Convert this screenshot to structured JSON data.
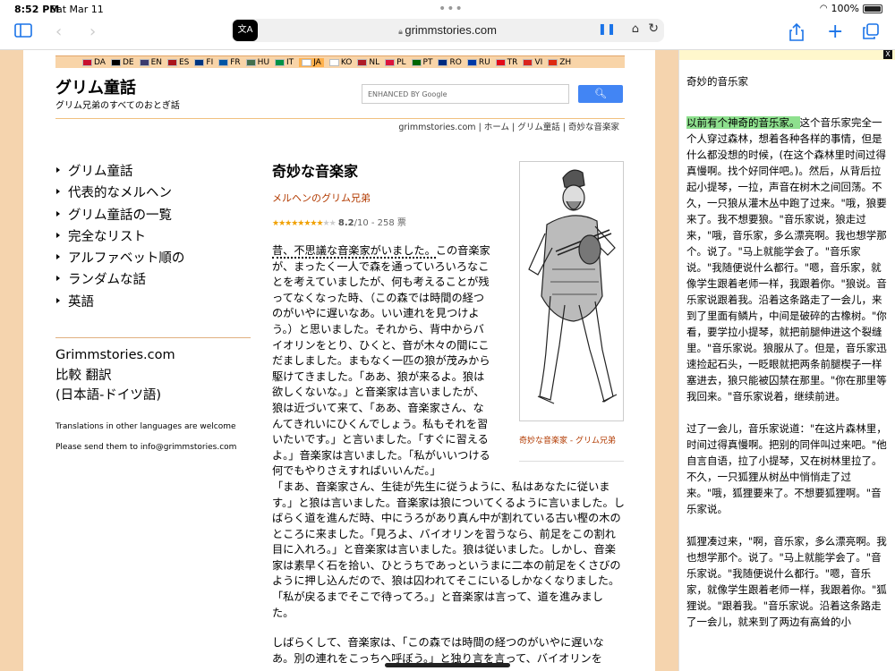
{
  "status": {
    "time": "8:52 PM",
    "date": "Sat Mar 11",
    "battery": "100%"
  },
  "browser": {
    "url": "grimmstories.com",
    "translate_label": "文A"
  },
  "site": {
    "title": "グリム童話",
    "subtitle": "グリム兄弟のすべてのおとぎ話",
    "search_placeholder": "ENHANCED BY Google",
    "languages": [
      "DA",
      "DE",
      "EN",
      "ES",
      "FI",
      "FR",
      "HU",
      "IT",
      "JA",
      "KO",
      "NL",
      "PL",
      "PT",
      "RO",
      "RU",
      "TR",
      "VI",
      "ZH"
    ],
    "active_language": "JA",
    "breadcrumb": "grimmstories.com | ホーム | グリム童話 | 奇妙な音楽家"
  },
  "nav": [
    "グリム童話",
    "代表的なメルヘン",
    "グリム童話の一覧",
    "完全なリスト",
    "アルファベット順の",
    "ランダムな話",
    "英語"
  ],
  "side_block": {
    "l1": "Grimmstories.com",
    "l2": "比較 翻訳",
    "l3": "(日本語-ドイツ語)",
    "t1": "Translations in other languages are welcome",
    "t2": "Please send them to info@grimmstories.com"
  },
  "story": {
    "title": "奇妙な音楽家",
    "author": "メルヘンのグリム兄弟",
    "rating_value": "8.2",
    "rating_rest": "/10 - 258 票",
    "rating_fraction": 0.82,
    "caption": "奇妙な音楽家 - グリム兄弟",
    "first": "昔、不思議な音楽家がいました。",
    "p1a": "この音楽家が、まったく一人で森を通っていろいろなことを考えていましたが、何も考えることが残ってなくなった時、（この森では時間の経つのがいやに遅いなあ。いい連れを見つけよう。）と思いました。それから、背中からバイオリンをとり、ひくと、音が木々の間にこだましました。まもなく一匹の狼が茂みから駆けてきました。「ああ、狼が来るよ。狼は欲しくないな。」と音楽家は言いましたが、狼は近づいて来て、「ああ、音楽家さん、なんてきれいにひくんでしょう。私もそれを習いたいです。」と言いました。「すぐに習えるよ。」音楽家は言いました。「私がいいつける何でもやりさえすればいいんだ。」",
    "p1b": "「まあ、音楽家さん、生徒が先生に従うように、私はあなたに従います。」と狼は言いました。音楽家は狼についてくるように言いました。しばらく道を進んだ時、中にうろがあり真ん中が割れている古い樫の木のところに来ました。「見ろよ、バイオリンを習うなら、前足をこの割れ目に入れろ。」と音楽家は言いました。狼は従いました。しかし、音楽家は素早く石を拾い、ひとうちであっというまに二本の前足をくさびのように押し込んだので、狼は囚われてそこにいるしかなくなりました。「私が戻るまでそこで待ってろ。」と音楽家は言って、道を進みました。",
    "p2": "しばらくして、音楽家は、「この森では時間の経つのがいやに遅いなあ。別の連れをこっちへ呼ぼう。」と独り言を言って、バイオリンを"
  },
  "translation": {
    "header": "奇妙的音乐家",
    "hl": "以前有个神奇的音乐家。",
    "p1": "这个音乐家完全一个人穿过森林，想着各种各样的事情，但是什么都没想的时候，(在这个森林里时间过得真慢啊。找个好同伴吧。)。然后，从背后拉起小提琴，一拉，声音在树木之间回荡。不久，一只狼从灌木丛中跑了过来。\"哦，狼要来了。我不想要狼。\"音乐家说，狼走过来，\"哦，音乐家，多么漂亮啊。我也想学那个。说了。\"马上就能学会了。\"音乐家说。\"我随便说什么都行。\"嗯，音乐家，就像学生跟着老师一样，我跟着你。\"狼说。音乐家说跟着我。沿着这条路走了一会儿，来到了里面有鳞片，中间是破碎的古橡树。\"你看，要学拉小提琴，就把前腿伸进这个裂缝里。\"音乐家说。狼服从了。但是，音乐家迅速捡起石头，一眨眼就把两条前腿楔子一样塞进去，狼只能被囚禁在那里。\"你在那里等我回来。\"音乐家说着，继续前进。",
    "p2": "过了一会儿，音乐家说道：\"在这片森林里，时间过得真慢啊。把别的同伴叫过来吧。\"他自言自语，拉了小提琴，又在树林里拉了。不久，一只狐狸从树丛中悄悄走了过来。\"哦，狐狸要来了。不想要狐狸啊。\"音乐家说。",
    "p3": "狐狸凑过来，\"啊，音乐家，多么漂亮啊。我也想学那个。说了。\"马上就能学会了。\"音乐家说。\"我随便说什么都行。\"嗯，音乐家，就像学生跟着老师一样，我跟着你。\"狐狸说。\"跟着我。\"音乐家说。沿着这条路走了一会儿，就来到了两边有高耸的小"
  }
}
